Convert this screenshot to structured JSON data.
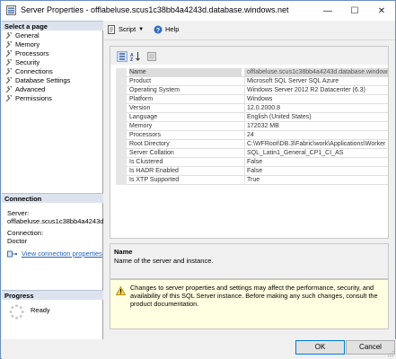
{
  "window": {
    "title": "Server Properties - offlabeluse.scus1c38bb4a4243d.database.windows.net",
    "minimize_glyph": "—",
    "maximize_glyph": "☐",
    "close_glyph": "✕"
  },
  "left": {
    "select_page_header": "Select a page",
    "pages": [
      "General",
      "Memory",
      "Processors",
      "Security",
      "Connections",
      "Database Settings",
      "Advanced",
      "Permissions"
    ],
    "connection_header": "Connection",
    "server_label": "Server:",
    "server_value": "offlabeluse.scus1c38bb4a4243d.database.windows.net",
    "connection_label": "Connection:",
    "connection_value": "Doctor",
    "view_link": "View connection properties",
    "progress_header": "Progress",
    "progress_status": "Ready"
  },
  "toolbar": {
    "script_label": "Script",
    "help_label": "Help"
  },
  "grid": {
    "rows": [
      {
        "key": "Name",
        "value": "offlabeluse.scus1c38bb4a4243d.database.windows.net"
      },
      {
        "key": "Product",
        "value": "Microsoft SQL Server SQL Azure"
      },
      {
        "key": "Operating System",
        "value": "Windows Server 2012 R2 Datacenter (6.3)"
      },
      {
        "key": "Platform",
        "value": "Windows"
      },
      {
        "key": "Version",
        "value": "12.0.2000.8"
      },
      {
        "key": "Language",
        "value": "English (United States)"
      },
      {
        "key": "Memory",
        "value": "172032 MB"
      },
      {
        "key": "Processors",
        "value": "24"
      },
      {
        "key": "Root Directory",
        "value": "C:\\WFRoot\\DB.3\\Fabric\\work\\Applications\\Worker"
      },
      {
        "key": "Server Collation",
        "value": "SQL_Latin1_General_CP1_CI_AS"
      },
      {
        "key": "Is Clustered",
        "value": "False"
      },
      {
        "key": "Is HADR Enabled",
        "value": "False"
      },
      {
        "key": "Is XTP Supported",
        "value": "True"
      }
    ]
  },
  "description": {
    "title": "Name",
    "text": "Name of the server and instance."
  },
  "warning": {
    "text": "Changes to server properties and settings may affect the performance, security, and availability of this SQL Server instance. Before making any such changes, consult the product documentation."
  },
  "buttons": {
    "ok": "OK",
    "cancel": "Cancel"
  }
}
